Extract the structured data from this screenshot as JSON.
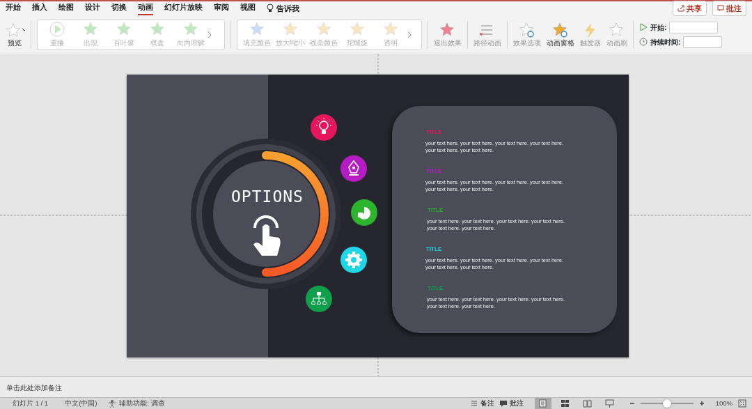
{
  "menu_tabs": [
    {
      "label": "开始",
      "selected": false
    },
    {
      "label": "插入",
      "selected": false
    },
    {
      "label": "绘图",
      "selected": false
    },
    {
      "label": "设计",
      "selected": false
    },
    {
      "label": "切换",
      "selected": false
    },
    {
      "label": "动画",
      "selected": true
    },
    {
      "label": "幻灯片放映",
      "selected": false
    },
    {
      "label": "审阅",
      "selected": false
    },
    {
      "label": "视图",
      "selected": false
    }
  ],
  "tell_me": "告诉我",
  "header_buttons": [
    "共享",
    "批注"
  ],
  "ribbon": {
    "preview": "预览",
    "entrance_gallery": [
      {
        "label": "重播",
        "disabled": true
      },
      {
        "label": "出现",
        "disabled": true
      },
      {
        "label": "百叶窗",
        "disabled": true
      },
      {
        "label": "棋盘",
        "disabled": true
      },
      {
        "label": "向内溶解",
        "disabled": true
      }
    ],
    "emphasis_gallery": [
      {
        "label": "填充颜色",
        "disabled": true
      },
      {
        "label": "放大/缩小",
        "disabled": true
      },
      {
        "label": "线条颜色",
        "disabled": true
      },
      {
        "label": "陀螺旋",
        "disabled": true
      },
      {
        "label": "透明",
        "disabled": true
      }
    ],
    "tools": [
      {
        "label": "退出效果",
        "disabled": true
      },
      {
        "label": "路径动画",
        "disabled": true
      },
      {
        "label": "效果选项",
        "disabled": true
      },
      {
        "label": "动画窗格",
        "disabled": false
      },
      {
        "label": "触发器",
        "disabled": true
      },
      {
        "label": "动画刷",
        "disabled": true
      }
    ],
    "start_label": "开始:",
    "duration_label": "持续时间:"
  },
  "slide": {
    "heading": "OPTIONS",
    "items": [
      {
        "title": "TITLE",
        "text": "your text here. your text here. your text here. your text here. your text here. your text here.",
        "color": "#e8175d"
      },
      {
        "title": "TITLE",
        "text": "your text here. your text here. your text here. your text here. your text here. your text here.",
        "color": "#b51cc4"
      },
      {
        "title": "TITLE",
        "text": "your text here. your text here. your text here. your text here. your text here. your text here.",
        "color": "#2db52d"
      },
      {
        "title": "TITLE",
        "text": "your text here. your text here. your text here. your text here. your text here. your text here.",
        "color": "#1fd6e6"
      },
      {
        "title": "TITLE",
        "text": "your text here. your text here. your text here. your text here. your text here. your text here.",
        "color": "#10a04c"
      }
    ]
  },
  "notes_placeholder": "单击此处添加备注",
  "status_bar": {
    "slide_count": "幻灯片 1 / 1",
    "language": "中文(中国)",
    "accessibility": "辅助功能: 调查",
    "notes": "备注",
    "comments": "批注",
    "views": [
      {
        "selected": true
      },
      {
        "selected": false
      },
      {
        "selected": false
      },
      {
        "selected": false
      }
    ],
    "zoom": {
      "level": 0.5,
      "reading": "100%"
    }
  }
}
